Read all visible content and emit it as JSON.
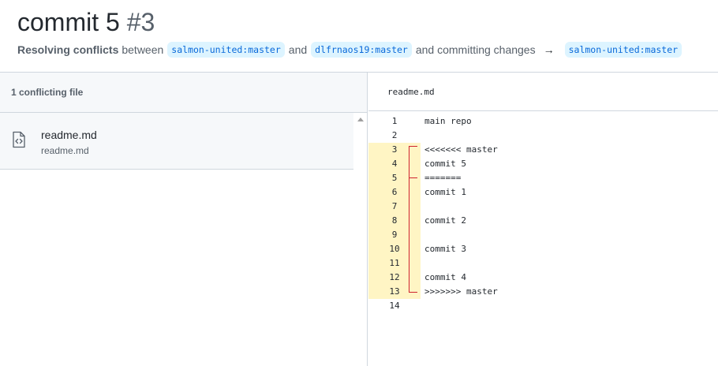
{
  "page": {
    "title": "commit 5",
    "number": "#3",
    "subtitle_bold": "Resolving conflicts",
    "between": "between",
    "branch_a": "salmon-united:master",
    "and": "and",
    "branch_b": "dlfrnaos19:master",
    "committing": "and committing changes",
    "arrow": "→",
    "branch_target": "salmon-united:master"
  },
  "sidebar": {
    "header": "1 conflicting file",
    "files": [
      {
        "name": "readme.md",
        "path": "readme.md",
        "icon": "file-code-icon"
      }
    ]
  },
  "editor": {
    "filename": "readme.md",
    "conflict_color": "#fff5c4",
    "marker_color": "#cf222e",
    "lines": [
      {
        "n": "1",
        "text": "main repo",
        "conflict": false
      },
      {
        "n": "2",
        "text": "",
        "conflict": false
      },
      {
        "n": "3",
        "text": "<<<<<<< master",
        "conflict": true
      },
      {
        "n": "4",
        "text": "commit 5",
        "conflict": true
      },
      {
        "n": "5",
        "text": "=======",
        "conflict": true
      },
      {
        "n": "6",
        "text": "commit 1",
        "conflict": true
      },
      {
        "n": "7",
        "text": "",
        "conflict": true
      },
      {
        "n": "8",
        "text": "commit 2",
        "conflict": true
      },
      {
        "n": "9",
        "text": "",
        "conflict": true
      },
      {
        "n": "10",
        "text": "commit 3",
        "conflict": true
      },
      {
        "n": "11",
        "text": "",
        "conflict": true
      },
      {
        "n": "12",
        "text": "commit 4",
        "conflict": true
      },
      {
        "n": "13",
        "text": ">>>>>>> master",
        "conflict": true
      },
      {
        "n": "14",
        "text": "",
        "conflict": false
      }
    ]
  }
}
